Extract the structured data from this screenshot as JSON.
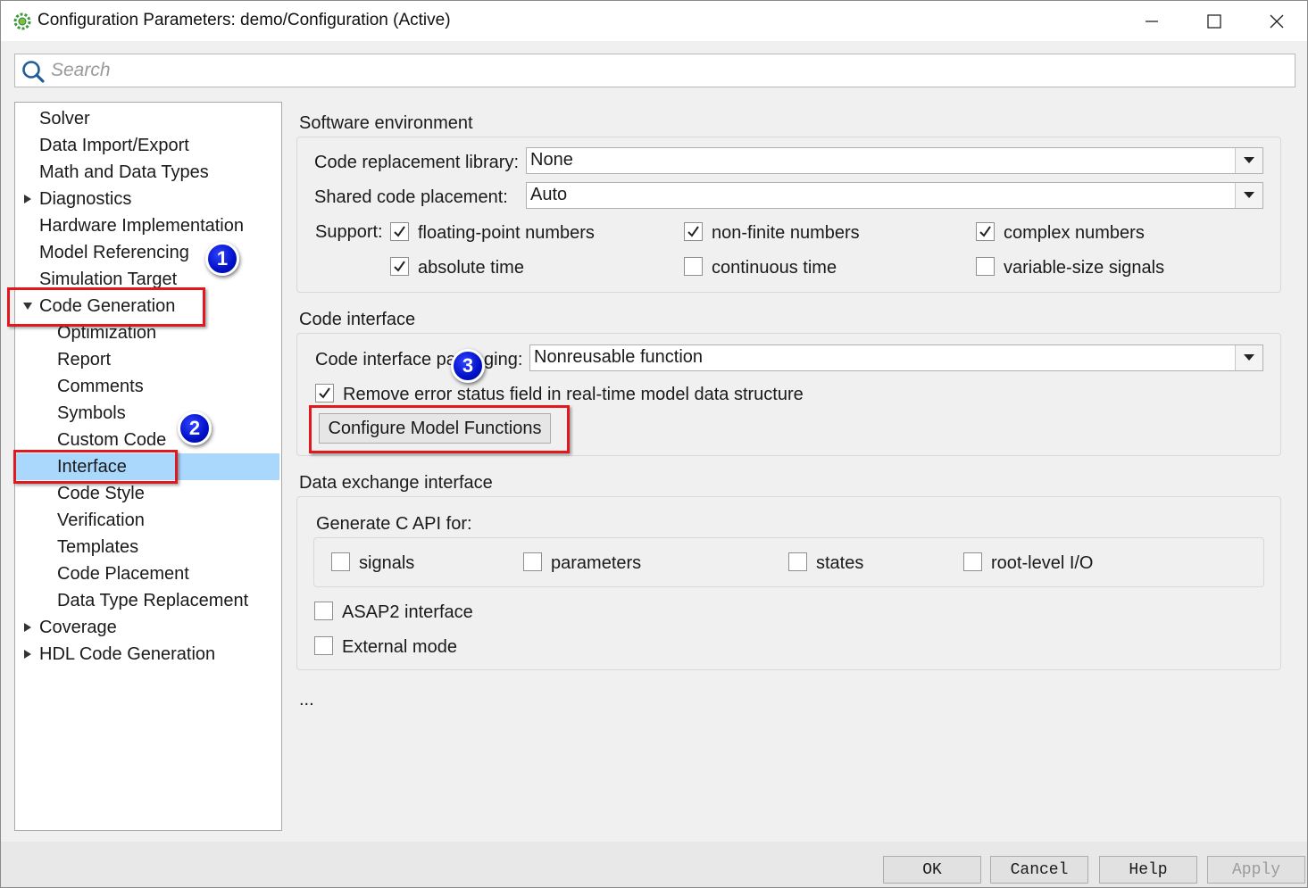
{
  "window": {
    "title": "Configuration Parameters: demo/Configuration (Active)"
  },
  "search": {
    "placeholder": "Search",
    "value": ""
  },
  "tree": {
    "items": [
      {
        "label": "Solver",
        "expandable": false
      },
      {
        "label": "Data Import/Export",
        "expandable": false
      },
      {
        "label": "Math and Data Types",
        "expandable": false
      },
      {
        "label": "Diagnostics",
        "expandable": true,
        "expanded": false
      },
      {
        "label": "Hardware Implementation",
        "expandable": false
      },
      {
        "label": "Model Referencing",
        "expandable": false
      },
      {
        "label": "Simulation Target",
        "expandable": false
      },
      {
        "label": "Code Generation",
        "expandable": true,
        "expanded": true
      },
      {
        "label": "Optimization",
        "child": true
      },
      {
        "label": "Report",
        "child": true
      },
      {
        "label": "Comments",
        "child": true
      },
      {
        "label": "Symbols",
        "child": true
      },
      {
        "label": "Custom Code",
        "child": true
      },
      {
        "label": "Interface",
        "child": true,
        "selected": true
      },
      {
        "label": "Code Style",
        "child": true
      },
      {
        "label": "Verification",
        "child": true
      },
      {
        "label": "Templates",
        "child": true
      },
      {
        "label": "Code Placement",
        "child": true
      },
      {
        "label": "Data Type Replacement",
        "child": true
      },
      {
        "label": "Coverage",
        "expandable": true,
        "expanded": false
      },
      {
        "label": "HDL Code Generation",
        "expandable": true,
        "expanded": false
      }
    ]
  },
  "software_env": {
    "title": "Software environment",
    "crl_label": "Code replacement library:",
    "crl_value": "None",
    "shared_label": "Shared code placement:",
    "shared_value": "Auto",
    "support_label": "Support:",
    "support": [
      {
        "label": "floating-point numbers",
        "checked": true
      },
      {
        "label": "non-finite numbers",
        "checked": true
      },
      {
        "label": "complex numbers",
        "checked": true
      },
      {
        "label": "absolute time",
        "checked": true
      },
      {
        "label": "continuous time",
        "checked": false
      },
      {
        "label": "variable-size signals",
        "checked": false
      }
    ]
  },
  "code_interface": {
    "title": "Code interface",
    "packaging_label": "Code interface packaging:",
    "packaging_value": "Nonreusable function",
    "remove_error_label": "Remove error status field in real-time model data structure",
    "remove_error_checked": true,
    "configure_button": "Configure Model Functions"
  },
  "data_exchange": {
    "title": "Data exchange interface",
    "capi_label": "Generate C API for:",
    "capi": [
      {
        "label": "signals",
        "checked": false
      },
      {
        "label": "parameters",
        "checked": false
      },
      {
        "label": "states",
        "checked": false
      },
      {
        "label": "root-level I/O",
        "checked": false
      }
    ],
    "asap2_label": "ASAP2 interface",
    "asap2_checked": false,
    "external_label": "External mode",
    "external_checked": false
  },
  "more_text": "...",
  "footer": {
    "ok": "OK",
    "cancel": "Cancel",
    "help": "Help",
    "apply": "Apply"
  },
  "annotations": {
    "badge1": "1",
    "badge2": "2",
    "badge3": "3",
    "highlight_color": "#e0191f",
    "badge_color": "#0010c8"
  },
  "colors": {
    "selection": "#aad8fc"
  }
}
